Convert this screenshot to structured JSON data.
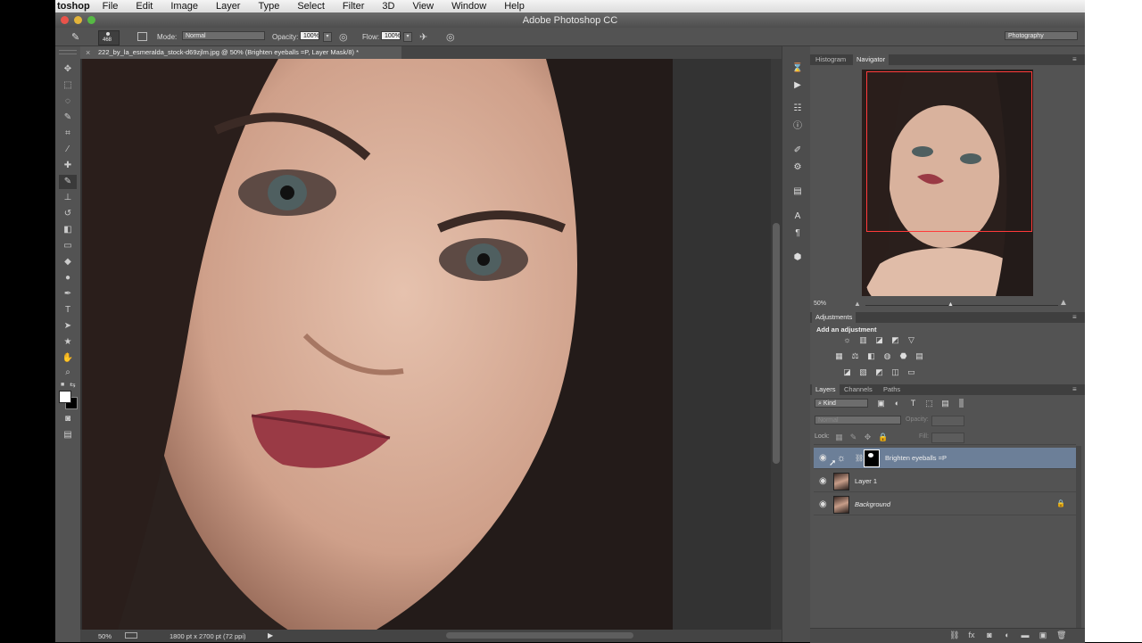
{
  "menu": {
    "app": "toshop",
    "items": [
      "File",
      "Edit",
      "Image",
      "Layer",
      "Type",
      "Select",
      "Filter",
      "3D",
      "View",
      "Window",
      "Help"
    ]
  },
  "window": {
    "title": "Adobe Photoshop CC"
  },
  "options": {
    "brush_size": "468",
    "mode_label": "Mode:",
    "mode_value": "Normal",
    "opacity_label": "Opacity:",
    "opacity_value": "100%",
    "flow_label": "Flow:",
    "flow_value": "100%",
    "workspace": "Photography"
  },
  "document": {
    "tab_title": "222_by_la_esmeralda_stock-d69zjlm.jpg @ 50% (Brighten eyeballs =P, Layer Mask/8) *",
    "zoom": "50%",
    "doc_info": "1800 pt x 2700 pt (72 ppi)"
  },
  "navigator": {
    "tabs": [
      "Histogram",
      "Navigator"
    ],
    "active_tab": "Navigator",
    "zoom": "50%"
  },
  "adjustments": {
    "title": "Adjustments",
    "subtitle": "Add an adjustment"
  },
  "layers_panel": {
    "tabs": [
      "Layers",
      "Channels",
      "Paths"
    ],
    "active_tab": "Layers",
    "filter_kind": "Kind",
    "blend_mode": "Normal",
    "opacity_label": "Opacity:",
    "lock_label": "Lock:",
    "fill_label": "Fill:",
    "layers": [
      {
        "name": "Brighten eyeballs =P",
        "selected": true
      },
      {
        "name": "Layer 1",
        "selected": false
      },
      {
        "name": "Background",
        "selected": false,
        "locked": true
      }
    ]
  },
  "colors": {
    "panel_bg": "#535353",
    "selected_layer": "#6c7f98",
    "nav_rect": "#ff3a3a"
  }
}
